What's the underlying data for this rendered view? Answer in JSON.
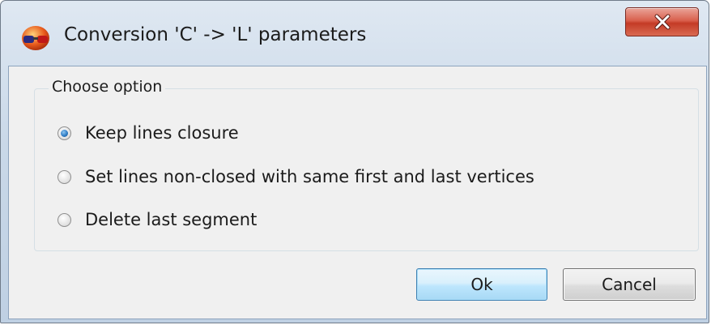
{
  "window": {
    "title": "Conversion 'C' -> 'L' parameters",
    "app_icon": "3d-glasses-icon",
    "close_icon": "close-icon"
  },
  "group": {
    "label": "Choose option",
    "options": [
      {
        "label": "Keep lines closure",
        "selected": true
      },
      {
        "label": "Set lines non-closed with same first and last vertices",
        "selected": false
      },
      {
        "label": "Delete last segment",
        "selected": false
      }
    ]
  },
  "buttons": {
    "ok_label": "Ok",
    "cancel_label": "Cancel"
  },
  "colors": {
    "close_button": "#c43b26",
    "radio_selected": "#2f7dc6",
    "ok_border": "#3c7fb1"
  }
}
